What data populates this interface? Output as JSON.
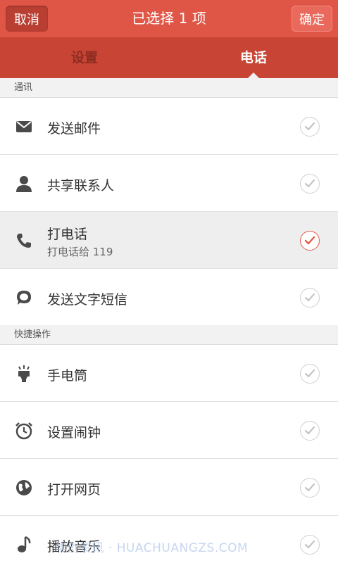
{
  "header": {
    "cancel_label": "取消",
    "title": "已选择 1 项",
    "ok_label": "确定"
  },
  "tabs": [
    {
      "label": "设置",
      "active": false
    },
    {
      "label": "电话",
      "active": true
    }
  ],
  "sections": [
    {
      "title": "通讯",
      "items": [
        {
          "label": "发送邮件",
          "icon": "mail-icon",
          "selected": false
        },
        {
          "label": "共享联系人",
          "icon": "person-icon",
          "selected": false
        },
        {
          "label": "打电话",
          "sub": "打电话给 119",
          "icon": "phone-icon",
          "selected": true
        },
        {
          "label": "发送文字短信",
          "icon": "message-bubble-icon",
          "selected": false
        }
      ]
    },
    {
      "title": "快捷操作",
      "items": [
        {
          "label": "手电筒",
          "icon": "flashlight-icon",
          "selected": false
        },
        {
          "label": "设置闹钟",
          "icon": "alarm-clock-icon",
          "selected": false
        },
        {
          "label": "打开网页",
          "icon": "globe-icon",
          "selected": false
        },
        {
          "label": "播放音乐",
          "icon": "music-note-icon",
          "selected": false
        }
      ]
    }
  ],
  "watermark": "华创资讯 · HUACHUANGZS.COM",
  "colors": {
    "header": "#df5546",
    "tabbar": "#c84536",
    "check_active": "#e35b4c",
    "check_idle": "#cccccc"
  }
}
